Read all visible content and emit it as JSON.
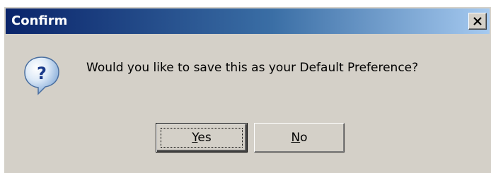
{
  "window": {
    "title": "Confirm"
  },
  "icons": {
    "dialog_icon": "question-icon",
    "close": "close-icon"
  },
  "message": "Would you like to save this as your Default Preference?",
  "buttons": {
    "yes": {
      "mnemonic": "Y",
      "rest": "es",
      "default": true
    },
    "no": {
      "mnemonic": "N",
      "rest": "o",
      "default": false
    }
  },
  "colors": {
    "titlebar_start": "#0a246a",
    "titlebar_end": "#a6caf0",
    "dialog_face": "#d4d0c8"
  }
}
